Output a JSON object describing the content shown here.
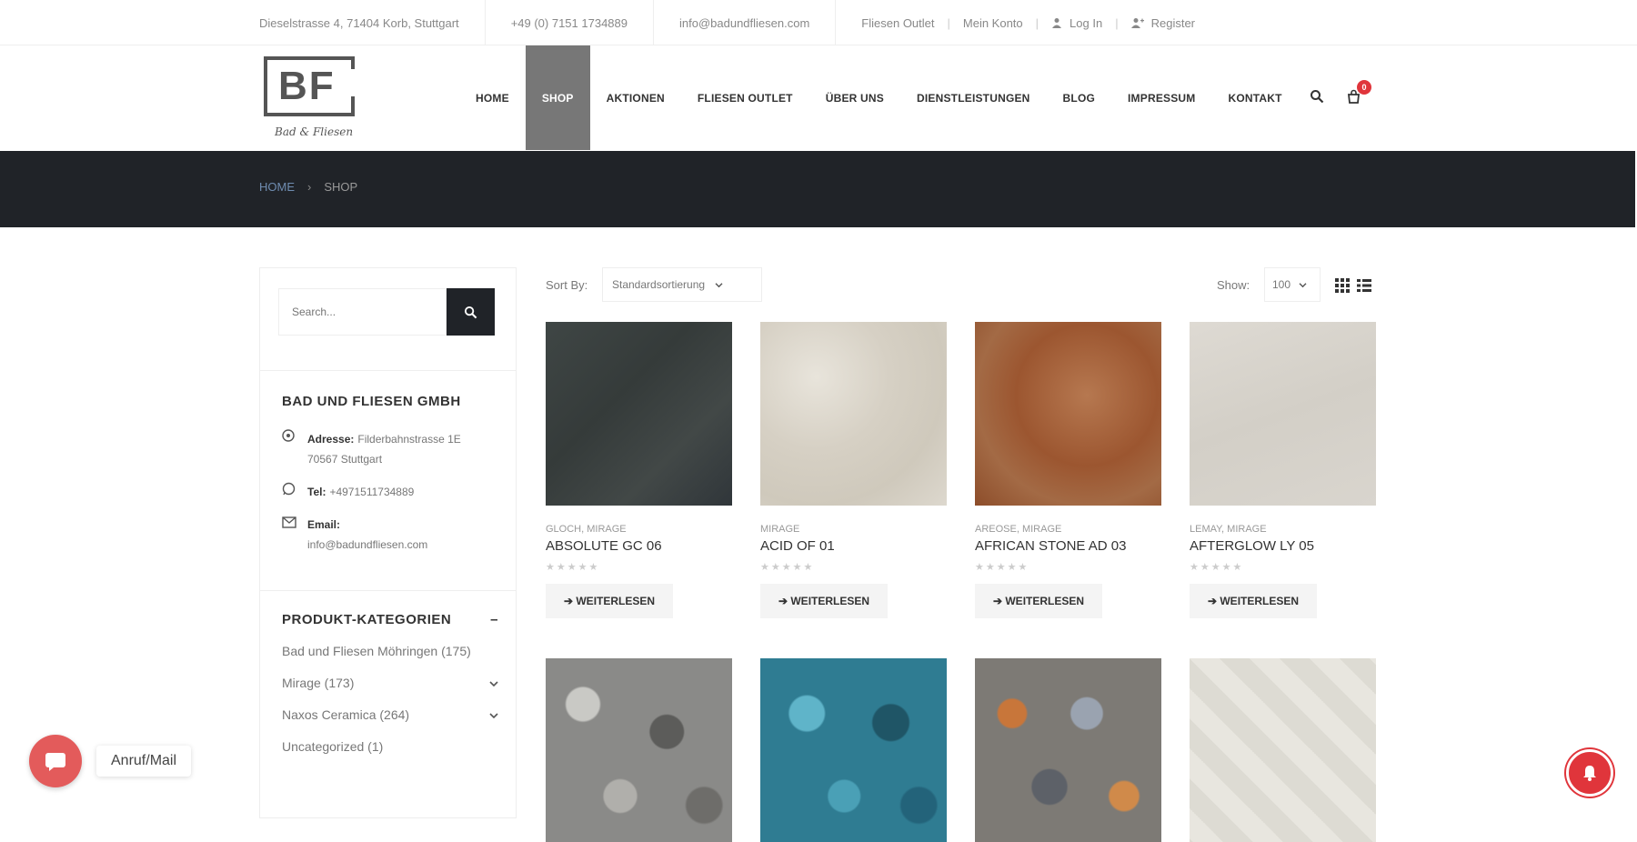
{
  "topbar": {
    "address": "Dieselstrasse 4, 71404 Korb, Stuttgart",
    "phone": "+49 (0) 7151 1734889",
    "email": "info@badundfliesen.com",
    "links": [
      "Fliesen Outlet",
      "Mein Konto"
    ],
    "login": "Log In",
    "register": "Register"
  },
  "logo": {
    "mark": "BF",
    "script": "Bad & Fliesen"
  },
  "nav": {
    "items": [
      "HOME",
      "SHOP",
      "AKTIONEN",
      "FLIESEN OUTLET",
      "ÜBER UNS",
      "DIENSTLEISTUNGEN",
      "BLOG",
      "IMPRESSUM",
      "KONTAKT"
    ],
    "active": "SHOP",
    "cart_count": "0"
  },
  "breadcrumb": {
    "home": "HOME",
    "separator": "›",
    "current": "SHOP"
  },
  "sidebar": {
    "search_placeholder": "Search...",
    "company_title": "BAD UND FLIESEN GMBH",
    "address_label": "Adresse:",
    "address_line1": "Filderbahnstrasse 1E",
    "address_line2": "70567 Stuttgart",
    "tel_label": "Tel:",
    "tel_value": "+4971511734889",
    "email_label": "Email:",
    "email_value": "info@badundfliesen.com",
    "categories_title": "PRODUKT-KATEGORIEN",
    "categories": [
      {
        "label": "Bad und Fliesen Möhringen (175)"
      },
      {
        "label": "Mirage (173)"
      },
      {
        "label": "Naxos Ceramica (264)"
      },
      {
        "label": "Uncategorized (1)"
      }
    ]
  },
  "toolbar": {
    "sort_label": "Sort By:",
    "sort_value": "Standardsortierung",
    "show_label": "Show:",
    "show_value": "100"
  },
  "products": [
    {
      "category": "GLOCH, MIRAGE",
      "name": "ABSOLUTE GC 06",
      "button": "WEITERLESEN",
      "color": "#3b4140"
    },
    {
      "category": "MIRAGE",
      "name": "ACID OF 01",
      "button": "WEITERLESEN",
      "color": "#d9d4c9"
    },
    {
      "category": "AREOSE, MIRAGE",
      "name": "AFRICAN STONE AD 03",
      "button": "WEITERLESEN",
      "color": "#a4603a"
    },
    {
      "category": "LEMAY, MIRAGE",
      "name": "AFTERGLOW LY 05",
      "button": "WEITERLESEN",
      "color": "#d6d2ca"
    },
    {
      "category": "",
      "name": "",
      "button": "",
      "color": "#8a8a88"
    },
    {
      "category": "",
      "name": "",
      "button": "",
      "color": "#2f7c92"
    },
    {
      "category": "",
      "name": "",
      "button": "",
      "color": "#7d7a75"
    },
    {
      "category": "",
      "name": "",
      "button": "",
      "color": "#e6e4dc"
    }
  ],
  "floating": {
    "label": "Anruf/Mail"
  },
  "icons": [
    "user-icon",
    "register-icon",
    "search-icon",
    "cart-icon",
    "grid-view-icon",
    "list-view-icon",
    "map-pin-icon",
    "whatsapp-icon",
    "mail-icon",
    "chevron-down-icon",
    "minus-icon",
    "arrow-right-icon",
    "chat-icon",
    "bell-icon"
  ]
}
